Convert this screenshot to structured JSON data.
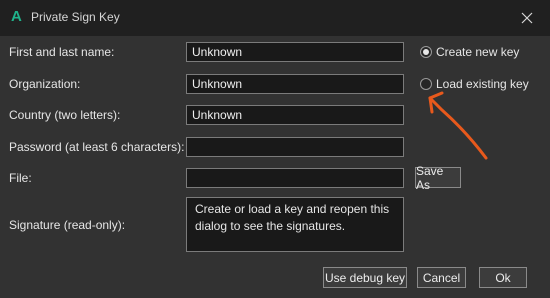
{
  "window": {
    "title": "Private Sign Key",
    "app_icon": "A"
  },
  "form": {
    "name_label": "First and last name:",
    "name_value": "Unknown",
    "org_label": "Organization:",
    "org_value": "Unknown",
    "country_label": "Country (two letters):",
    "country_value": "Unknown",
    "password_label": "Password (at least 6 characters):",
    "password_value": "",
    "file_label": "File:",
    "file_value": "",
    "save_as_label": "Save As",
    "signature_label": "Signature (read-only):",
    "signature_text": "Create or load a key and reopen this dialog to see the signatures."
  },
  "options": {
    "create_new": "Create new key",
    "load_existing": "Load existing key",
    "selected": "create_new"
  },
  "buttons": {
    "debug": "Use debug key",
    "cancel": "Cancel",
    "ok": "Ok"
  },
  "colors": {
    "annotation": "#e8591c",
    "app_icon": "#1fb38b"
  }
}
